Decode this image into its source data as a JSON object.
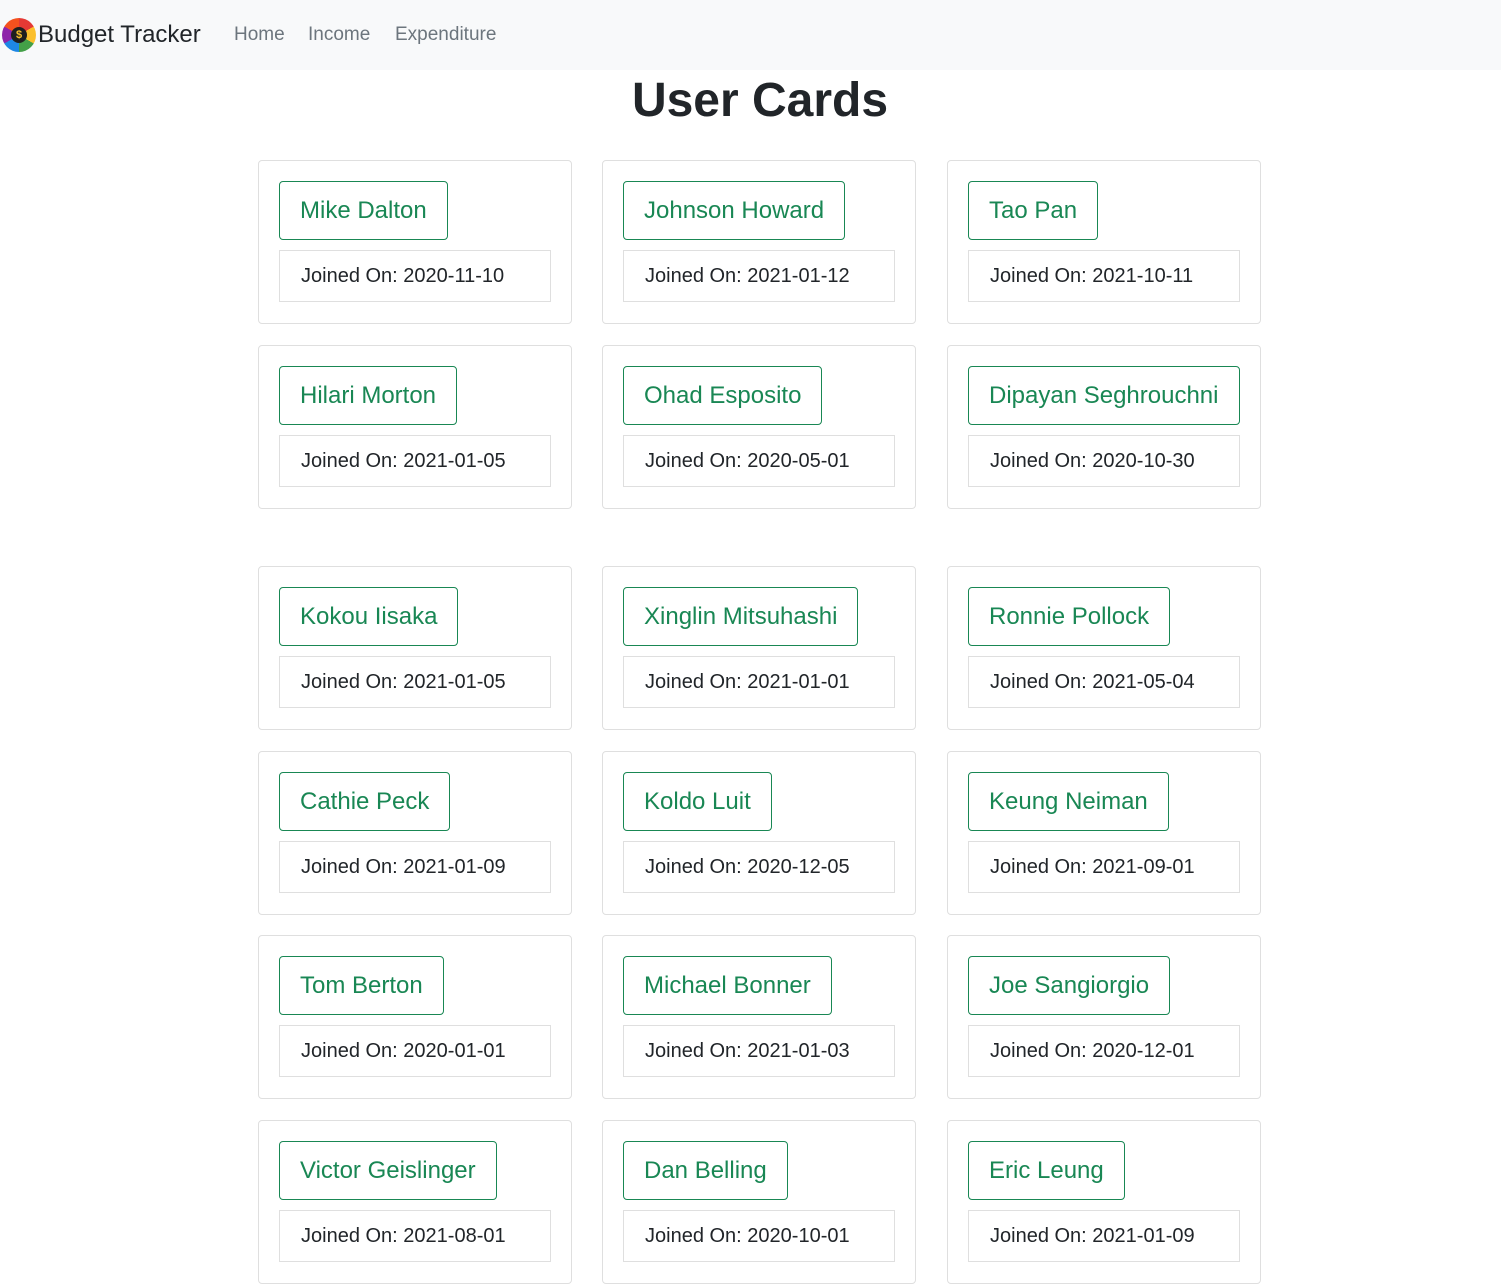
{
  "nav": {
    "brand": "Budget Tracker",
    "brand_logo_glyph": "$",
    "links": [
      "Home",
      "Income",
      "Expenditure"
    ]
  },
  "page": {
    "title": "User Cards"
  },
  "joined_prefix": "Joined On: ",
  "colors": {
    "accent": "#198754",
    "navbar_bg": "#f8f9fa",
    "nav_link": "#6c757d",
    "border": "#dfdfdf"
  },
  "users": [
    {
      "name": "Mike Dalton",
      "joined": "2020-11-10"
    },
    {
      "name": "Johnson Howard",
      "joined": "2021-01-12"
    },
    {
      "name": "Tao Pan",
      "joined": "2021-10-11"
    },
    {
      "name": "Hilari Morton",
      "joined": "2021-01-05"
    },
    {
      "name": "Ohad Esposito",
      "joined": "2020-05-01"
    },
    {
      "name": "Dipayan Seghrouchni",
      "joined": "2020-10-30"
    },
    {
      "name": "Kokou Iisaka",
      "joined": "2021-01-05"
    },
    {
      "name": "Xinglin Mitsuhashi",
      "joined": "2021-01-01"
    },
    {
      "name": "Ronnie Pollock",
      "joined": "2021-05-04"
    },
    {
      "name": "Cathie Peck",
      "joined": "2021-01-09"
    },
    {
      "name": "Koldo Luit",
      "joined": "2020-12-05"
    },
    {
      "name": "Keung Neiman",
      "joined": "2021-09-01"
    },
    {
      "name": "Tom Berton",
      "joined": "2020-01-01"
    },
    {
      "name": "Michael Bonner",
      "joined": "2021-01-03"
    },
    {
      "name": "Joe Sangiorgio",
      "joined": "2020-12-01"
    },
    {
      "name": "Victor Geislinger",
      "joined": "2021-08-01"
    },
    {
      "name": "Dan Belling",
      "joined": "2020-10-01"
    },
    {
      "name": "Eric Leung",
      "joined": "2021-01-09"
    }
  ]
}
